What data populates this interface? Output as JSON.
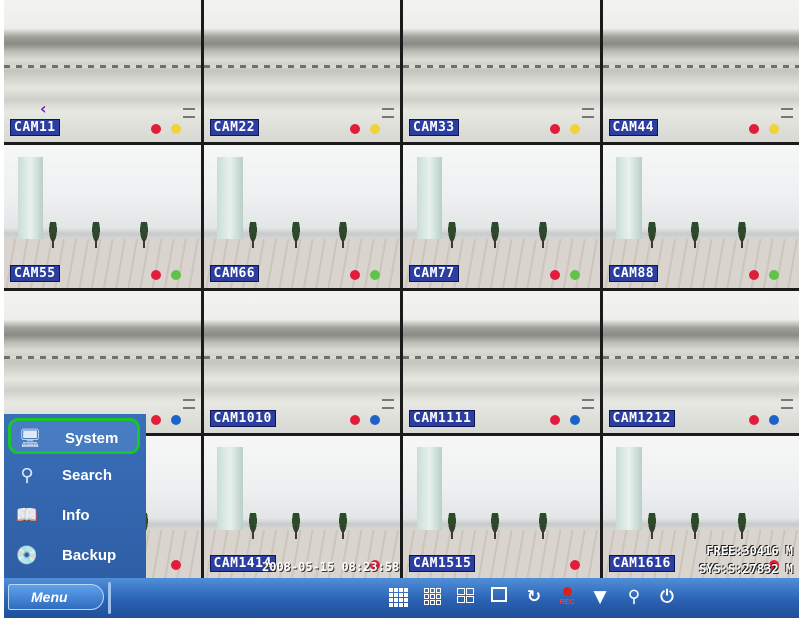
{
  "cameras": [
    {
      "label": "CAM11",
      "scene": "outdoor",
      "dot1": "#e01e3c",
      "dot2": "#f0d23a",
      "audio": true
    },
    {
      "label": "CAM22",
      "scene": "outdoor",
      "dot1": "#e01e3c",
      "dot2": "#f0d23a"
    },
    {
      "label": "CAM33",
      "scene": "outdoor",
      "dot1": "#e01e3c",
      "dot2": "#f0d23a"
    },
    {
      "label": "CAM44",
      "scene": "outdoor",
      "dot1": "#e01e3c",
      "dot2": "#f0d23a"
    },
    {
      "label": "CAM55",
      "scene": "indoor",
      "dot1": "#e01e3c",
      "dot2": "#5fc24a"
    },
    {
      "label": "CAM66",
      "scene": "indoor",
      "dot1": "#e01e3c",
      "dot2": "#5fc24a"
    },
    {
      "label": "CAM77",
      "scene": "indoor",
      "dot1": "#e01e3c",
      "dot2": "#5fc24a"
    },
    {
      "label": "CAM88",
      "scene": "indoor",
      "dot1": "#e01e3c",
      "dot2": "#5fc24a"
    },
    {
      "label": "",
      "scene": "outdoor",
      "dot1": "#e01e3c",
      "dot2": "#1e63c8"
    },
    {
      "label": "CAM1010",
      "scene": "outdoor",
      "dot1": "#e01e3c",
      "dot2": "#1e63c8"
    },
    {
      "label": "CAM1111",
      "scene": "outdoor",
      "dot1": "#e01e3c",
      "dot2": "#1e63c8"
    },
    {
      "label": "CAM1212",
      "scene": "outdoor",
      "dot1": "#e01e3c",
      "dot2": "#1e63c8"
    },
    {
      "label": "",
      "scene": "indoor",
      "dot1": "#e01e3c",
      "dot2": ""
    },
    {
      "label": "CAM1414",
      "scene": "indoor",
      "dot1": "#e01e3c",
      "dot2": ""
    },
    {
      "label": "CAM1515",
      "scene": "indoor",
      "dot1": "#e01e3c",
      "dot2": ""
    },
    {
      "label": "CAM1616",
      "scene": "indoor",
      "dot1": "#e01e3c",
      "dot2": ""
    }
  ],
  "osd": {
    "line1": "FREE:30416 M",
    "line2": "SYS:S:27832 M",
    "timestamp": "2008-05-15 08:23:58"
  },
  "menu": {
    "items": [
      {
        "label": "System",
        "icon": "system-monitor-icon",
        "selected": true
      },
      {
        "label": "Search",
        "icon": "search-icon"
      },
      {
        "label": "Info",
        "icon": "info-book-icon"
      },
      {
        "label": "Backup",
        "icon": "backup-disc-icon"
      }
    ],
    "button_label": "Menu"
  },
  "toolbar": {
    "rec_label": "REC",
    "buttons": [
      "layout-16-icon",
      "layout-9-icon",
      "layout-4-icon",
      "layout-1-icon",
      "sequence-rotate-icon",
      "record-icon",
      "ptz-dome-camera-icon",
      "zoom-icon",
      "power-icon"
    ]
  }
}
